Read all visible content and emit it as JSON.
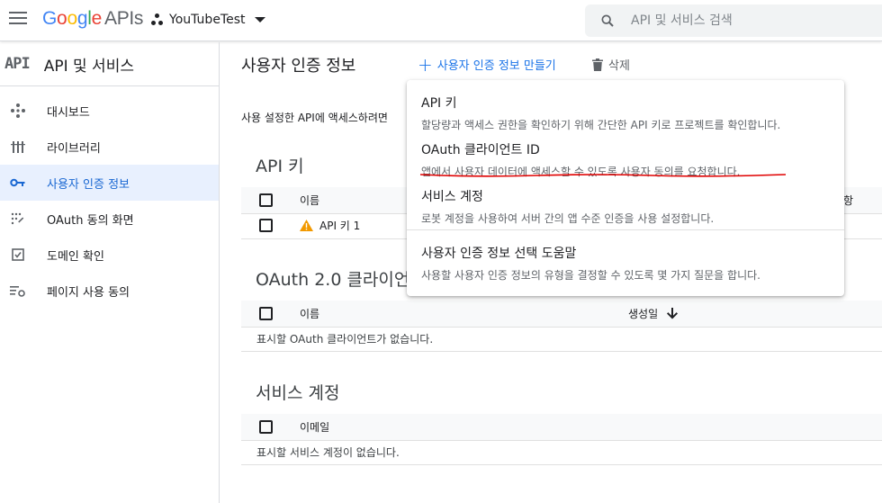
{
  "header": {
    "logo_google": "Google",
    "logo_apis": "APIs",
    "project_name": "YouTubeTest",
    "search_placeholder": "API 및 서비스 검색"
  },
  "sidebar": {
    "api_logo": "API",
    "title": "API 및 서비스",
    "items": [
      {
        "label": "대시보드",
        "icon": "dashboard-icon",
        "active": false
      },
      {
        "label": "라이브러리",
        "icon": "library-icon",
        "active": false
      },
      {
        "label": "사용자 인증 정보",
        "icon": "key-icon",
        "active": true
      },
      {
        "label": "OAuth 동의 화면",
        "icon": "consent-screen-icon",
        "active": false
      },
      {
        "label": "도메인 확인",
        "icon": "domain-check-icon",
        "active": false
      },
      {
        "label": "페이지 사용 동의",
        "icon": "page-settings-icon",
        "active": false
      }
    ]
  },
  "main": {
    "title": "사용자 인증 정보",
    "create_label": "사용자 인증 정보 만들기",
    "delete_label": "삭제",
    "description": "사용 설정한 API에 액세스하려면",
    "api_keys": {
      "title": "API 키",
      "col_name": "이름",
      "col_restrict_partial": "항",
      "rows": [
        {
          "name": "API 키 1"
        }
      ]
    },
    "oauth": {
      "title": "OAuth 2.0 클라이언",
      "col_name": "이름",
      "col_created": "생성일",
      "empty": "표시할 OAuth 클라이언트가 없습니다."
    },
    "service_accounts": {
      "title": "서비스 계정",
      "col_email": "이메일",
      "empty": "표시할 서비스 계정이 없습니다."
    }
  },
  "dropdown": {
    "options": [
      {
        "title": "API 키",
        "desc": "할당량과 액세스 권한을 확인하기 위해 간단한 API 키로 프로젝트를 확인합니다."
      },
      {
        "title": "OAuth 클라이언트 ID",
        "desc": "앱에서 사용자 데이터에 액세스할 수 있도록 사용자 동의를 요청합니다."
      },
      {
        "title": "서비스 계정",
        "desc": "로봇 계정을 사용하여 서버 간의 앱 수준 인증을 사용 설정합니다."
      },
      {
        "title": "사용자 인증 정보 선택 도움말",
        "desc": "사용할 사용자 인증 정보의 유형을 결정할 수 있도록 몇 가지 질문을 합니다."
      }
    ]
  },
  "colors": {
    "accent": "#1a73e8",
    "active_bg": "#e8f0fe",
    "warning": "#f29900",
    "annotation_red": "#e00000"
  }
}
